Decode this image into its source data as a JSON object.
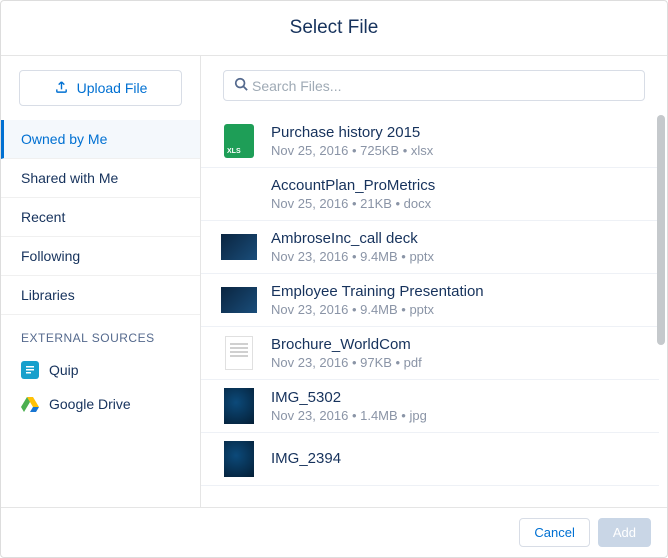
{
  "header": {
    "title": "Select File"
  },
  "sidebar": {
    "upload_label": "Upload File",
    "items": [
      {
        "label": "Owned by Me",
        "active": true
      },
      {
        "label": "Shared with Me",
        "active": false
      },
      {
        "label": "Recent",
        "active": false
      },
      {
        "label": "Following",
        "active": false
      },
      {
        "label": "Libraries",
        "active": false
      }
    ],
    "external_title": "EXTERNAL SOURCES",
    "external": [
      {
        "label": "Quip",
        "icon": "quip-icon"
      },
      {
        "label": "Google Drive",
        "icon": "google-drive-icon"
      }
    ]
  },
  "search": {
    "placeholder": "Search Files..."
  },
  "files": [
    {
      "name": "Purchase history 2015",
      "date": "Nov 25, 2016",
      "size": "725KB",
      "ext": "xlsx",
      "thumb": "xls"
    },
    {
      "name": "AccountPlan_ProMetrics",
      "date": "Nov 25, 2016",
      "size": "21KB",
      "ext": "docx",
      "thumb": "blank"
    },
    {
      "name": "AmbroseInc_call deck",
      "date": "Nov 23, 2016",
      "size": "9.4MB",
      "ext": "pptx",
      "thumb": "pptx"
    },
    {
      "name": "Employee Training Presentation",
      "date": "Nov 23, 2016",
      "size": "9.4MB",
      "ext": "pptx",
      "thumb": "pptx"
    },
    {
      "name": "Brochure_WorldCom",
      "date": "Nov 23, 2016",
      "size": "97KB",
      "ext": "pdf",
      "thumb": "pdf"
    },
    {
      "name": "IMG_5302",
      "date": "Nov 23, 2016",
      "size": "1.4MB",
      "ext": "jpg",
      "thumb": "jpg"
    },
    {
      "name": "IMG_2394",
      "date": "",
      "size": "",
      "ext": "",
      "thumb": "jpg"
    }
  ],
  "footer": {
    "cancel_label": "Cancel",
    "add_label": "Add"
  }
}
